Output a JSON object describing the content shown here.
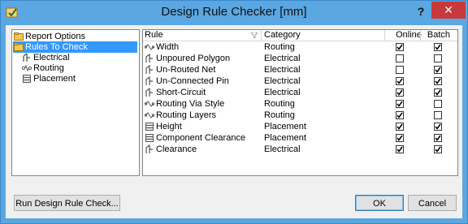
{
  "window": {
    "title": "Design Rule Checker [mm]",
    "help_label": "?",
    "close_label": "✕"
  },
  "tree": {
    "items": [
      {
        "label": "Report Options",
        "icon": "folder-icon"
      },
      {
        "label": "Rules To Check",
        "icon": "folder-icon",
        "selected": true
      },
      {
        "label": "Electrical",
        "icon": "electrical-rule-icon"
      },
      {
        "label": "Routing",
        "icon": "routing-rule-icon"
      },
      {
        "label": "Placement",
        "icon": "placement-rule-icon"
      }
    ]
  },
  "grid": {
    "columns": [
      "Rule",
      "Category",
      "Online",
      "Batch"
    ],
    "rows": [
      {
        "rule": "Width",
        "category": "Routing",
        "online": true,
        "batch": true
      },
      {
        "rule": "Unpoured Polygon",
        "category": "Electrical",
        "online": false,
        "batch": false
      },
      {
        "rule": "Un-Routed Net",
        "category": "Electrical",
        "online": false,
        "batch": true
      },
      {
        "rule": "Un-Connected Pin",
        "category": "Electrical",
        "online": true,
        "batch": true
      },
      {
        "rule": "Short-Circuit",
        "category": "Electrical",
        "online": true,
        "batch": true
      },
      {
        "rule": "Routing Via Style",
        "category": "Routing",
        "online": true,
        "batch": false
      },
      {
        "rule": "Routing Layers",
        "category": "Routing",
        "online": true,
        "batch": false
      },
      {
        "rule": "Height",
        "category": "Placement",
        "online": true,
        "batch": true
      },
      {
        "rule": "Component Clearance",
        "category": "Placement",
        "online": true,
        "batch": true
      },
      {
        "rule": "Clearance",
        "category": "Electrical",
        "online": true,
        "batch": true
      }
    ]
  },
  "buttons": {
    "run": "Run Design Rule Check...",
    "ok": "OK",
    "cancel": "Cancel"
  }
}
